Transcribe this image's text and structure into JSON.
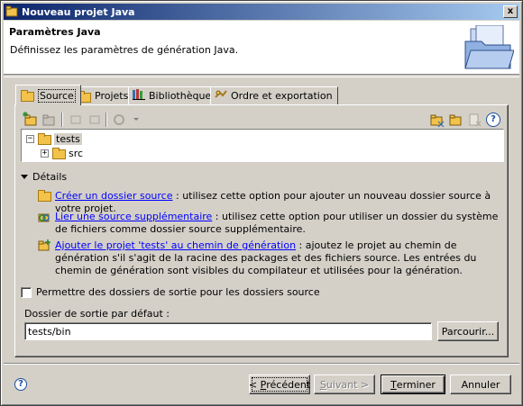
{
  "window": {
    "title": "Nouveau projet Java",
    "close_glyph": "x"
  },
  "banner": {
    "title": "Paramètres Java",
    "description": "Définissez les paramètres de génération Java.",
    "icon": "new-java-project-wizard-icon"
  },
  "tabs": [
    {
      "label": "Source",
      "icon": "source-folder-icon",
      "active": true
    },
    {
      "label": "Projets",
      "icon": "project-icon",
      "active": false
    },
    {
      "label": "Bibliothèques",
      "icon": "library-icon",
      "active": false
    },
    {
      "label": "Ordre et exportation",
      "icon": "order-export-icon",
      "active": false
    }
  ],
  "toolbar": {
    "left": [
      "add-source-folder-icon",
      "link-source-icon",
      "include-icon",
      "exclude-icon",
      "configure-icon"
    ],
    "right": [
      "add-folder-icon",
      "open-folder-icon",
      "remove-icon",
      "help-icon"
    ],
    "help_glyph": "?"
  },
  "tree": {
    "root": {
      "label": "tests",
      "expander": "−"
    },
    "child": {
      "label": "src",
      "expander": "+"
    }
  },
  "details": {
    "header": "Détails",
    "items": [
      {
        "link": "Créer un dossier source",
        "text": " : utilisez cette option pour ajouter un nouveau dossier source à votre projet."
      },
      {
        "link": "Lier une source supplémentaire",
        "text": " : utilisez cette option pour utiliser un dossier du système de fichiers comme dossier source supplémentaire."
      },
      {
        "link": "Ajouter le projet 'tests' au chemin de génération",
        "text": " : ajoutez le projet au chemin de génération s'il s'agit de la racine des packages et des fichiers source. Les entrées du chemin de génération sont visibles du compilateur et utilisées pour la génération."
      }
    ]
  },
  "output": {
    "checkbox_label": "Permettre des dossiers de sortie pour les dossiers source",
    "checkbox_checked": false,
    "default_label": "Dossier de sortie par défaut :",
    "default_value": "tests/bin",
    "browse_label": "Parcourir..."
  },
  "buttons": {
    "help_glyph": "?",
    "prev_a": "< ",
    "prev_u": "P",
    "prev_b": "récédent",
    "next_a": "",
    "next_u": "S",
    "next_b": "uivant >",
    "finish_a": "",
    "finish_u": "T",
    "finish_b": "erminer",
    "cancel": "Annuler"
  },
  "colors": {
    "titlebar_start": "#0a246a",
    "titlebar_end": "#a6caf0",
    "dialog_bg": "#d4d0c8",
    "link": "#0000ff",
    "folder": "#f2c24a"
  }
}
